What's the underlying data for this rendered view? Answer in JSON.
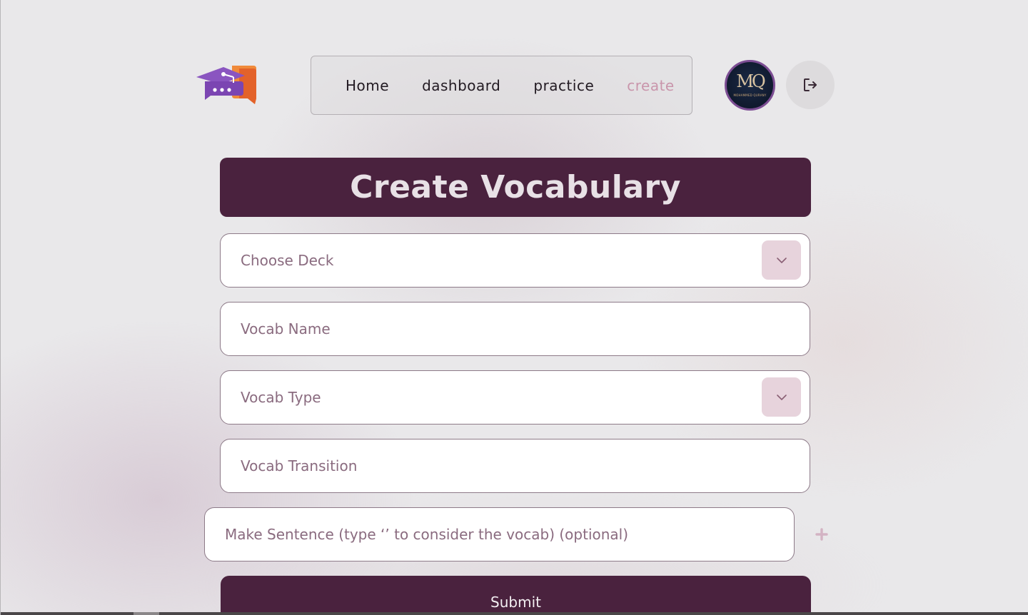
{
  "app": {
    "logo_icon": "graduation-cap-chat-logo"
  },
  "nav": {
    "items": [
      {
        "label": "Home",
        "active": false
      },
      {
        "label": "dashboard",
        "active": false
      },
      {
        "label": "practice",
        "active": false
      },
      {
        "label": "create",
        "active": true
      }
    ],
    "active_color": "#c995ab"
  },
  "user": {
    "avatar_monogram": "MQ",
    "avatar_caption": "MOHAMMED QURANY",
    "logout_icon": "logout-icon"
  },
  "form": {
    "title": "Create Vocabulary",
    "deck_select_placeholder": "Choose Deck",
    "vocab_name_placeholder": "Vocab Name",
    "vocab_type_placeholder": "Vocab Type",
    "vocab_transition_placeholder": "Vocab Transition",
    "sentence_placeholder": "Make Sentence (type ‘’ to consider the vocab) (optional)",
    "add_sentence_icon": "plus-icon",
    "submit_label": "Submit"
  },
  "colors": {
    "primary": "#4a223e",
    "accent_soft": "#e7d3dc",
    "placeholder": "#8a6b7f"
  }
}
